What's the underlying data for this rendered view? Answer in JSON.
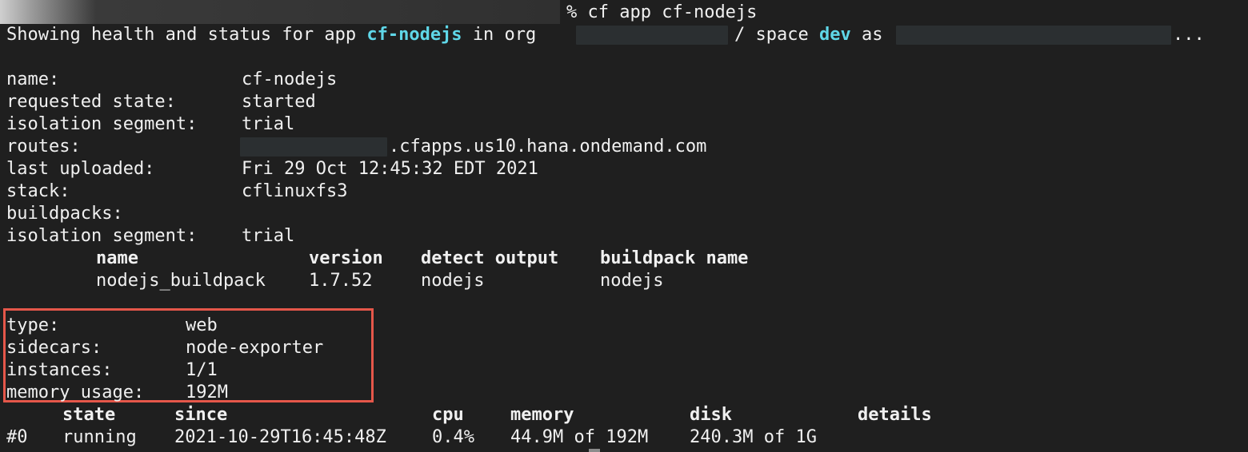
{
  "prompt": {
    "symbol": "%",
    "command": "cf app cf-nodejs"
  },
  "status_line": {
    "prefix": "Showing health and status for app",
    "app": "cf-nodejs",
    "in_org": "in org",
    "space_sep": "/ space",
    "space": "dev",
    "as_text": "as",
    "ellipsis": "..."
  },
  "app_info": {
    "name_label": "name:",
    "name_value": "cf-nodejs",
    "requested_state_label": "requested state:",
    "requested_state_value": "started",
    "isolation_segment_label": "isolation segment:",
    "isolation_segment_value": "trial",
    "routes_label": "routes:",
    "routes_suffix": ".cfapps.us10.hana.ondemand.com",
    "last_uploaded_label": "last uploaded:",
    "last_uploaded_value": "Fri 29 Oct 12:45:32 EDT 2021",
    "stack_label": "stack:",
    "stack_value": "cflinuxfs3",
    "buildpacks_label": "buildpacks:",
    "isolation_segment2_label": "isolation segment:",
    "isolation_segment2_value": "trial"
  },
  "buildpacks_table": {
    "headers": [
      "name",
      "version",
      "detect output",
      "buildpack name"
    ],
    "rows": [
      [
        "nodejs_buildpack",
        "1.7.52",
        "nodejs",
        "nodejs"
      ]
    ]
  },
  "process": {
    "type_label": "type:",
    "type_value": "web",
    "sidecars_label": "sidecars:",
    "sidecars_value": "node-exporter",
    "instances_label": "instances:",
    "instances_value": "1/1",
    "memory_usage_label": "memory usage:",
    "memory_usage_value": "192M"
  },
  "instances_table": {
    "headers": [
      "state",
      "since",
      "cpu",
      "memory",
      "disk",
      "details"
    ],
    "rows": [
      {
        "index": "#0",
        "state": "running",
        "since": "2021-10-29T16:45:48Z",
        "cpu": "0.4%",
        "memory": "44.9M of 192M",
        "disk": "240.3M of 1G",
        "details": ""
      }
    ]
  },
  "colors": {
    "background": "#1f1f1f",
    "text": "#f0f0f0",
    "accent_cyan": "#5fd7e8",
    "highlight_red": "#e5574a",
    "redaction": "#2b2f31"
  }
}
